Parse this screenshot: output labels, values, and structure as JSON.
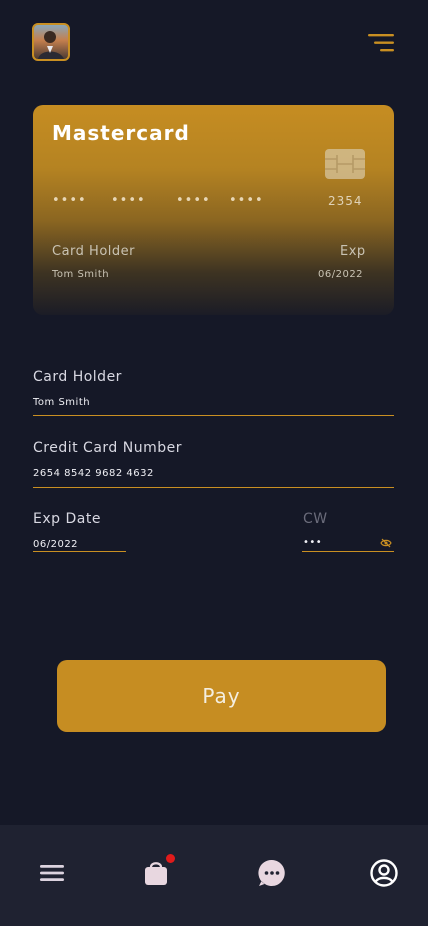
{
  "header": {
    "avatar_icon": "user-avatar",
    "menu_icon": "sort-lines-icon"
  },
  "card": {
    "brand": "Mastercard",
    "masked_groups": [
      "••••",
      "••••",
      "••••",
      "••••"
    ],
    "last_digits": "2354",
    "holder_label": "Card Holder",
    "holder_value": "Tom Smith",
    "exp_label": "Exp",
    "exp_value": "06/2022"
  },
  "form": {
    "card_holder_label": "Card Holder",
    "card_holder_value": "Tom Smith",
    "card_number_label": "Credit Card Number",
    "card_number_value": "2654 8542 9682 4632",
    "exp_date_label": "Exp Date",
    "exp_date_value": "06/2022",
    "cvv_label": "CW",
    "cvv_value": "•••"
  },
  "pay_button": {
    "label": "Pay"
  },
  "bottom_nav": {
    "items": [
      "menu-icon",
      "shopping-bag-icon",
      "chat-icon",
      "profile-icon"
    ]
  },
  "colors": {
    "background": "#151827",
    "accent": "#c68d22",
    "nav_background": "#1f2231",
    "badge": "#e01b1b"
  }
}
